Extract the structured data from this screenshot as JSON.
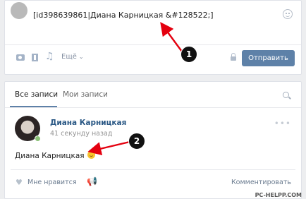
{
  "composer": {
    "input_value": "[id398639861|Диана Карницкая &#128522;]",
    "more_label": "Ещё",
    "send_label": "Отправить",
    "icons": [
      "camera-icon",
      "video-icon",
      "music-icon",
      "lock-icon",
      "smile-icon"
    ]
  },
  "annotations": {
    "marker_1": "1",
    "marker_2": "2",
    "arrow_color": "#e4000f"
  },
  "feed": {
    "tabs": [
      "Все записи",
      "Мои записи"
    ],
    "post": {
      "author": "Диана Карницкая",
      "time": "41 секунду назад",
      "text": "Диана Карницкая",
      "like_label": "Мне нравится",
      "comment_label": "Комментировать"
    }
  },
  "watermark": "PC-HELPP.COM",
  "colors": {
    "accent": "#5e81a8",
    "author_link": "#2a5885",
    "online": "#8ac176"
  }
}
